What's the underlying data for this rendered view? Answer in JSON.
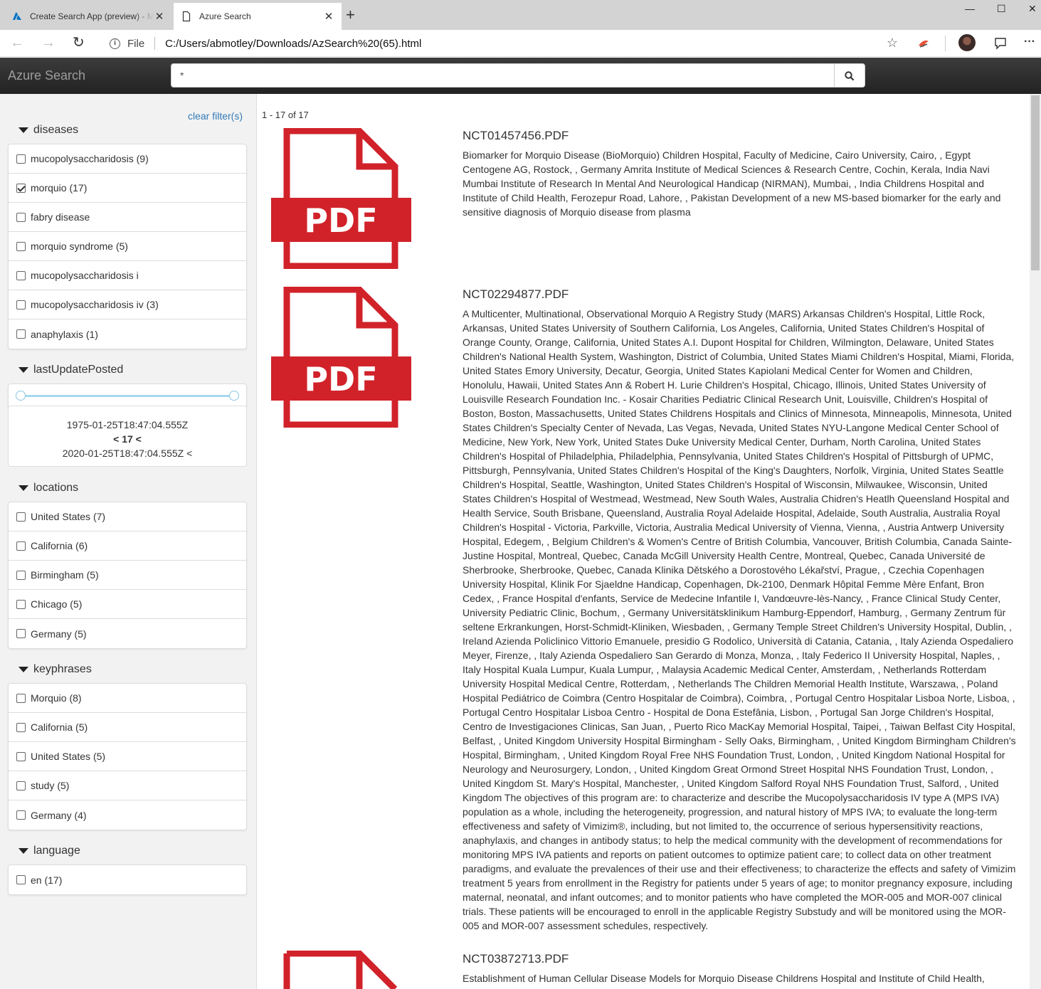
{
  "browser": {
    "tabs": [
      {
        "label": "Create Search App (preview) - Microsoft Azure",
        "close": "✕"
      },
      {
        "label": "Azure Search",
        "close": "✕"
      }
    ],
    "new_tab": "+",
    "window_controls": {
      "minimize": "—",
      "maximize": "☐",
      "close": "✕"
    },
    "nav": {
      "back": "←",
      "forward": "→",
      "refresh": "↻"
    },
    "url": {
      "info": "i",
      "file_label": "File",
      "address": "C:/Users/abmotley/Downloads/AzSearch%20(65).html"
    },
    "toolbar_icons": [
      "star-icon",
      "extension-icon",
      "profile-avatar",
      "feedback-icon",
      "more-icon"
    ],
    "more_glyph": "···"
  },
  "header": {
    "brand": "Azure Search",
    "search_value": "*"
  },
  "sidebar": {
    "clear_filters": "clear filter(s)",
    "facets": {
      "diseases": {
        "title": "diseases",
        "items": [
          {
            "label": "mucopolysaccharidosis (9)",
            "checked": false
          },
          {
            "label": "morquio (17)",
            "checked": true
          },
          {
            "label": "fabry disease",
            "checked": false
          },
          {
            "label": "morquio syndrome (5)",
            "checked": false
          },
          {
            "label": "mucopolysaccharidosis i",
            "checked": false
          },
          {
            "label": "mucopolysaccharidosis iv (3)",
            "checked": false
          },
          {
            "label": "anaphylaxis (1)",
            "checked": false
          }
        ]
      },
      "lastUpdatePosted": {
        "title": "lastUpdatePosted",
        "range_min": 0,
        "range_max": 1,
        "from": "1975-01-25T18:47:04.555Z",
        "count": "< 17 <",
        "to": "2020-01-25T18:47:04.555Z <"
      },
      "locations": {
        "title": "locations",
        "items": [
          {
            "label": "United States (7)",
            "checked": false
          },
          {
            "label": "California (6)",
            "checked": false
          },
          {
            "label": "Birmingham (5)",
            "checked": false
          },
          {
            "label": "Chicago (5)",
            "checked": false
          },
          {
            "label": "Germany (5)",
            "checked": false
          }
        ]
      },
      "keyphrases": {
        "title": "keyphrases",
        "items": [
          {
            "label": "Morquio (8)",
            "checked": false
          },
          {
            "label": "California (5)",
            "checked": false
          },
          {
            "label": "United States (5)",
            "checked": false
          },
          {
            "label": "study (5)",
            "checked": false
          },
          {
            "label": "Germany (4)",
            "checked": false
          }
        ]
      },
      "language": {
        "title": "language",
        "items": [
          {
            "label": "en (17)",
            "checked": false
          }
        ]
      }
    }
  },
  "results": {
    "count_text": "1 - 17 of 17",
    "pdf_label": "PDF",
    "items": [
      {
        "title": "NCT01457456.PDF",
        "text": "Biomarker for Morquio Disease (BioMorquio) Children Hospital, Faculty of Medicine, Cairo University, Cairo, , Egypt Centogene AG, Rostock, , Germany Amrita Institute of Medical Sciences & Research Centre, Cochin, Kerala, India Navi Mumbai Institute of Research In Mental And Neurological Handicap (NIRMAN), Mumbai, , India Childrens Hospital and Institute of Child Health, Ferozepur Road, Lahore, , Pakistan Development of a new MS-based biomarker for the early and sensitive diagnosis of Morquio disease from plasma"
      },
      {
        "title": "NCT02294877.PDF",
        "text": "A Multicenter, Multinational, Observational Morquio A Registry Study (MARS) Arkansas Children's Hospital, Little Rock, Arkansas, United States University of Southern California, Los Angeles, California, United States Children's Hospital of Orange County, Orange, California, United States A.I. Dupont Hospital for Children, Wilmington, Delaware, United States Children's National Health System, Washington, District of Columbia, United States Miami Children's Hospital, Miami, Florida, United States Emory University, Decatur, Georgia, United States Kapiolani Medical Center for Women and Children, Honolulu, Hawaii, United States Ann & Robert H. Lurie Children's Hospital, Chicago, Illinois, United States University of Louisville Research Foundation Inc. - Kosair Charities Pediatric Clinical Research Unit, Louisville, Children's Hospital of Boston, Boston, Massachusetts, United States Childrens Hospitals and Clinics of Minnesota, Minneapolis, Minnesota, United States Children's Specialty Center of Nevada, Las Vegas, Nevada, United States NYU-Langone Medical Center School of Medicine, New York, New York, United States Duke University Medical Center, Durham, North Carolina, United States Children's Hospital of Philadelphia, Philadelphia, Pennsylvania, United States Children's Hospital of Pittsburgh of UPMC, Pittsburgh, Pennsylvania, United States Children's Hospital of the King's Daughters, Norfolk, Virginia, United States Seattle Children's Hospital, Seattle, Washington, United States Children's Hospital of Wisconsin, Milwaukee, Wisconsin, United States Children's Hospital of Westmead, Westmead, New South Wales, Australia Chidren's Heatlh Queensland Hospital and Health Service, South Brisbane, Queensland, Australia Royal Adelaide Hospital, Adelaide, South Australia, Australia Royal Children's Hospital - Victoria, Parkville, Victoria, Australia Medical University of Vienna, Vienna, , Austria Antwerp University Hospital, Edegem, , Belgium Children's & Women's Centre of British Columbia, Vancouver, British Columbia, Canada Sainte-Justine Hospital, Montreal, Quebec, Canada McGill University Health Centre, Montreal, Quebec, Canada Université de Sherbrooke, Sherbrooke, Quebec, Canada Klinika Dětského a Dorostového Lékařství, Prague, , Czechia Copenhagen University Hospital, Klinik For Sjaeldne Handicap, Copenhagen, Dk-2100, Denmark Hôpital Femme Mère Enfant, Bron Cedex, , France Hospital d'enfants, Service de Medecine Infantile I, Vandœuvre-lès-Nancy, , France Clinical Study Center, University Pediatric Clinic, Bochum, , Germany Universitätsklinikum Hamburg-Eppendorf, Hamburg, , Germany Zentrum für seltene Erkrankungen, Horst-Schmidt-Kliniken, Wiesbaden, , Germany Temple Street Children's University Hospital, Dublin, , Ireland Azienda Policlinico Vittorio Emanuele, presidio G Rodolico, Università di Catania, Catania, , Italy Azienda Ospedaliero Meyer, Firenze, , Italy Azienda Ospedaliero San Gerardo di Monza, Monza, , Italy Federico II University Hospital, Naples, , Italy Hospital Kuala Lumpur, Kuala Lumpur, , Malaysia Academic Medical Center, Amsterdam, , Netherlands Rotterdam University Hospital Medical Centre, Rotterdam, , Netherlands The Children Memorial Health Institute, Warszawa, , Poland Hospital Pediátrico de Coimbra (Centro Hospitalar de Coimbra), Coimbra, , Portugal Centro Hospitalar Lisboa Norte, Lisboa, , Portugal Centro Hospitalar Lisboa Centro - Hospital de Dona Estefânia, Lisbon, , Portugal San Jorge Children's Hospital, Centro de Investigaciones Clinicas, San Juan, , Puerto Rico MacKay Memorial Hospital, Taipei, , Taiwan Belfast City Hospital, Belfast, , United Kingdom University Hospital Birmingham - Selly Oaks, Birmingham, , United Kingdom Birmingham Children's Hospital, Birmingham, , United Kingdom Royal Free NHS Foundation Trust, London, , United Kingdom National Hospital for Neurology and Neurosurgery, London, , United Kingdom Great Ormond Street Hospital NHS Foundation Trust, London, , United Kingdom St. Mary's Hospital, Manchester, , United Kingdom Salford Royal NHS Foundation Trust, Salford, , United Kingdom The objectives of this program are: to characterize and describe the Mucopolysaccharidosis IV type A (MPS IVA) population as a whole, including the heterogeneity, progression, and natural history of MPS IVA; to evaluate the long-term effectiveness and safety of Vimizim®, including, but not limited to, the occurrence of serious hypersensitivity reactions, anaphylaxis, and changes in antibody status; to help the medical community with the development of recommendations for monitoring MPS IVA patients and reports on patient outcomes to optimize patient care; to collect data on other treatment paradigms, and evaluate the prevalences of their use and their effectiveness; to characterize the effects and safety of Vimizim treatment 5 years from enrollment in the Registry for patients under 5 years of age; to monitor pregnancy exposure, including maternal, neonatal, and infant outcomes; and to monitor patients who have completed the MOR-005 and MOR-007 clinical trials. These patients will be encouraged to enroll in the applicable Registry Substudy and will be monitored using the MOR-005 and MOR-007 assessment schedules, respectively."
      },
      {
        "title": "NCT03872713.PDF",
        "text": "Establishment of Human Cellular Disease Models for Morquio Disease Childrens Hospital and Institute of Child Health,"
      }
    ]
  },
  "colors": {
    "pdf_red": "#d1222a",
    "link_blue": "#337ab7",
    "header_dark": "#222222",
    "slider_blue": "#a6d8f0"
  }
}
